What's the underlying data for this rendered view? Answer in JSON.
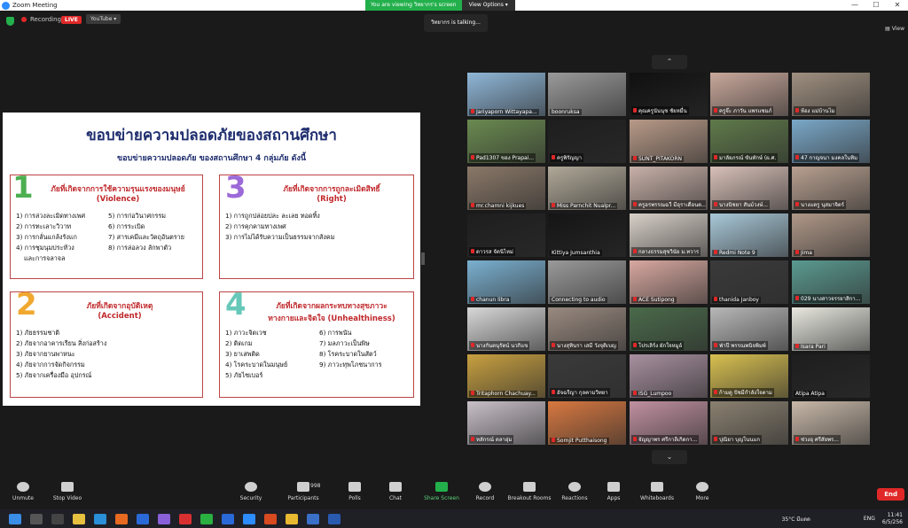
{
  "window": {
    "title": "Zoom Meeting",
    "controls": [
      "—",
      "☐",
      "✕"
    ]
  },
  "share_banner": {
    "viewing": "You are viewing วิทยากร's screen",
    "view_options": "View Options ▾"
  },
  "topbar": {
    "recording": "Recording",
    "live": "LIVE",
    "youtube": "YouTube ▾",
    "view": "▤ View"
  },
  "talking": "วิทยากร is talking...",
  "slide": {
    "title": "ขอบข่ายความปลอดภัยของสถานศึกษา",
    "subtitle": "ขอบข่ายความปลอดภัย ของสถานศึกษา 4 กลุ่มภัย ดังนี้",
    "boxes": [
      {
        "num": "1",
        "num_color": "#4caf50",
        "head1": "ภัยที่เกิดจากการใช้ความรุนแรงของมนุษย์",
        "head2": "(Violence)",
        "left": [
          "1) การล่วงละเมิดทางเพศ",
          "2) การทะเลาะวิวาท",
          "3) การกลั่นแกล้งรังแก",
          "4) การชุมนุมประท้วง",
          "    และการจลาจล"
        ],
        "right": [
          "5) การก่อวินาศกรรม",
          "6) การระเบิด",
          "7) สารเคมีและวัตถุอันตราย",
          "8) การล่อลวง ลักพาตัว"
        ]
      },
      {
        "num": "3",
        "num_color": "#9c6ad8",
        "head1": "ภัยที่เกิดจากการถูกละเมิดสิทธิ์",
        "head2": "(Right)",
        "left": [
          "1) การถูกปล่อยปละ ละเลย ทอดทิ้ง",
          "2) การคุกคามทางเพศ",
          "3) การไม่ได้รับความเป็นธรรมจากสังคม"
        ],
        "right": []
      },
      {
        "num": "2",
        "num_color": "#f0a830",
        "head1": "ภัยที่เกิดจากอุบัติเหตุ",
        "head2": "(Accident)",
        "left": [
          "1) ภัยธรรมชาติ",
          "2) ภัยจากอาคารเรียน สิ่งก่อสร้าง",
          "3) ภัยจากยานพาหนะ",
          "4) ภัยจากการจัดกิจกรรม",
          "5) ภัยจากเครื่องมือ อุปกรณ์"
        ],
        "right": []
      },
      {
        "num": "4",
        "num_color": "#66c8b8",
        "head1": "ภัยที่เกิดจากผลกระทบทางสุขภาวะ",
        "head2": "ทางกายและจิตใจ (Unhealthiness)",
        "left": [
          "1) ภาวะจิตเวช",
          "2) ติดเกม",
          "3) ยาเสพติด",
          "4) โรคระบาดในมนุษย์",
          "5) ภัยไซเบอร์"
        ],
        "right": [
          "6) การพนัน",
          "7) มลภาวะเป็นพิษ",
          "8) โรคระบาดในสัตว์",
          "9) ภาวะทุพโภชนาการ"
        ]
      }
    ]
  },
  "participants": [
    {
      "name": "Jariyaporn Wittayapa...",
      "muted": true,
      "color": "#8fb7d8"
    },
    {
      "name": "boonruksa",
      "muted": false,
      "color": "#9a9a9a"
    },
    {
      "name": "คุณครูนันนุช ชัยหมื่น",
      "muted": true,
      "color": "#101010"
    },
    {
      "name": "ครูจ๊ะ ภาวัน แพรแซมภ์",
      "muted": true,
      "color": "#c9a89b"
    },
    {
      "name": "ห้อง แม่บ้านไม",
      "muted": true,
      "color": "#a09080"
    },
    {
      "name": "Pad1307 ของ Prapai...",
      "muted": true,
      "color": "#6a8a50"
    },
    {
      "name": "ครูพิรัญญา",
      "muted": true,
      "color": "#1e1e1e"
    },
    {
      "name": "SUNT_PITAKORN",
      "muted": true,
      "color": "#b89a88"
    },
    {
      "name": "มาลัยภรณ์ ขันทักษ์ (ผ.ศ.",
      "muted": true,
      "color": "#5f7a4a"
    },
    {
      "name": "47 กาญจนา มงคลในทิม",
      "muted": true,
      "color": "#7aa8c8"
    },
    {
      "name": "mr.chamni kijkues",
      "muted": true,
      "color": "#8a7868"
    },
    {
      "name": "Miss Parnchit Nualpr...",
      "muted": true,
      "color": "#b0a898"
    },
    {
      "name": "ครูอรพรรณฉวี มีอุราเดือนด...",
      "muted": true,
      "color": "#c8b0a8"
    },
    {
      "name": "นางนิชยา สันม์วงษ์...",
      "muted": true,
      "color": "#d8c0b8"
    },
    {
      "name": "นางแตรู นุสมาจิตร์",
      "muted": true,
      "color": "#b8a090"
    },
    {
      "name": "ดาวรส จัดนิไหม่",
      "muted": true,
      "color": "#1e1e1e"
    },
    {
      "name": "Kittiya Jumsanthia",
      "muted": false,
      "color": "#151515"
    },
    {
      "name": "กลางธรรมสุขวินัย ม.ทวาร",
      "muted": true,
      "color": "#d8d0c8"
    },
    {
      "name": "Redmi Note 9",
      "muted": true,
      "color": "#a8c8d8"
    },
    {
      "name": "Jima",
      "muted": true,
      "color": "#b09888"
    },
    {
      "name": "chanun libra",
      "muted": true,
      "color": "#7ab0d0"
    },
    {
      "name": "Connecting to audio",
      "muted": false,
      "color": "#9a9a9a"
    },
    {
      "name": "ACE Sutipong",
      "muted": true,
      "color": "#d8a8a0"
    },
    {
      "name": "thanida Janboy",
      "muted": true,
      "color": "#3a3a3a"
    },
    {
      "name": "029 นางสาวจรรยาสิกา...",
      "muted": true,
      "color": "#5a9a90"
    },
    {
      "name": "นางกันตนุรัตน์ นวกิแข",
      "muted": true,
      "color": "#d8d8d8"
    },
    {
      "name": "นางสุทินรา เสมี วังจุติเบญ",
      "muted": true,
      "color": "#9a8a80"
    },
    {
      "name": "โปรเลิร์ง ผักใจหมูอ์",
      "muted": true,
      "color": "#4a6a4a"
    },
    {
      "name": "ฟ่าปี พรรณพนิจพิมพ์",
      "muted": true,
      "color": "#b8b8b8"
    },
    {
      "name": "Isara Pari",
      "muted": true,
      "color": "#e8e8e0"
    },
    {
      "name": "Tritaphorn Chachuay...",
      "muted": true,
      "color": "#c8a040"
    },
    {
      "name": "อัจฉรีญา กุลคามวิทยา",
      "muted": true,
      "color": "#3a3a3a"
    },
    {
      "name": "ISG_Lumpoo",
      "muted": true,
      "color": "#a890a0"
    },
    {
      "name": "ก้ามดู ปัชมีกำลังใจตาม",
      "muted": true,
      "color": "#d8c050"
    },
    {
      "name": "Atipa Atipa",
      "muted": false,
      "color": "#1e1e1e"
    },
    {
      "name": "หลักรณ์ ดลาอุ่ม",
      "muted": true,
      "color": "#c8c0c8"
    },
    {
      "name": "Somjit Putthaisong",
      "muted": true,
      "color": "#d87840"
    },
    {
      "name": "จัญญาพร ศรีกาลีเกิดกา...",
      "muted": true,
      "color": "#c090a0"
    },
    {
      "name": "ปุณิยา บุญโนนแก",
      "muted": true,
      "color": "#8a8070"
    },
    {
      "name": "ช่วงอุ ศรีสัยพร...",
      "muted": true,
      "color": "#c8b8a8"
    }
  ],
  "pager": {
    "up": "⌃",
    "down": "⌄"
  },
  "toolbar": {
    "unmute": "Unmute",
    "stop_video": "Stop Video",
    "security": "Security",
    "participants": "Participants",
    "participant_count": "998",
    "polls": "Polls",
    "chat": "Chat",
    "share_screen": "Share Screen",
    "record": "Record",
    "breakout": "Breakout Rooms",
    "reactions": "Reactions",
    "apps": "Apps",
    "whiteboards": "Whiteboards",
    "more": "More",
    "end": "End"
  },
  "taskbar": {
    "weather": "35°C มีแดด",
    "lang": "ENG",
    "time": "11:41",
    "date": "6/5/256"
  }
}
